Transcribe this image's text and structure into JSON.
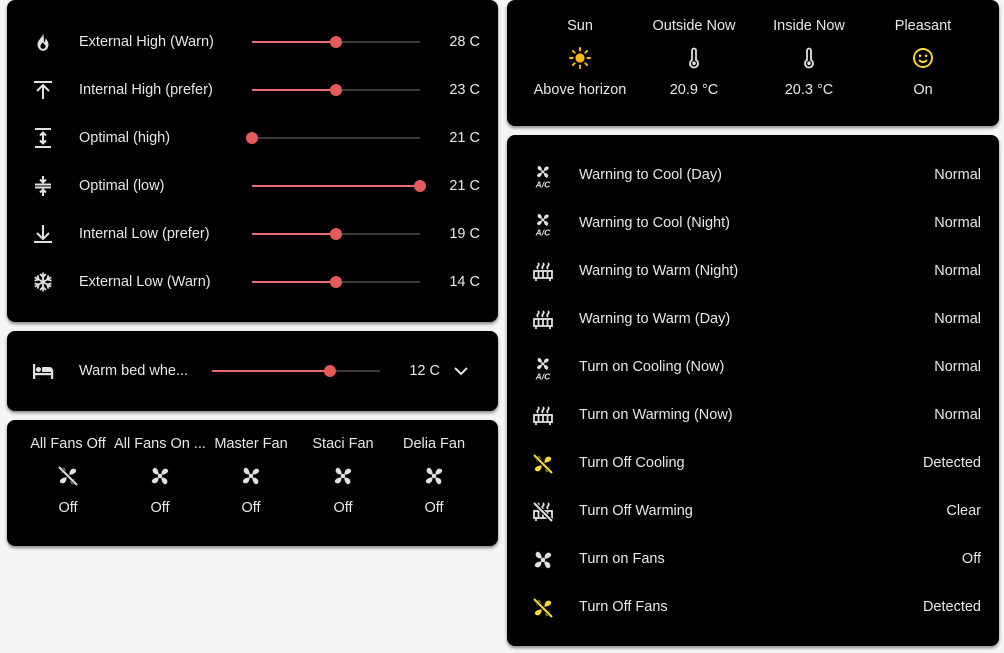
{
  "thresholds": [
    {
      "label": "External High (Warn)",
      "value": "28 C",
      "icon": "fire-icon",
      "fraction": 0.5
    },
    {
      "label": "Internal High (prefer)",
      "value": "23 C",
      "icon": "arrow-collapse-up-icon",
      "fraction": 0.5
    },
    {
      "label": "Optimal (high)",
      "value": "21 C",
      "icon": "arrow-expand-vertical-icon",
      "fraction": 0.0
    },
    {
      "label": "Optimal (low)",
      "value": "21 C",
      "icon": "arrow-collapse-vertical-icon",
      "fraction": 1.0
    },
    {
      "label": "Internal Low (prefer)",
      "value": "19 C",
      "icon": "arrow-collapse-down-icon",
      "fraction": 0.5
    },
    {
      "label": "External Low (Warn)",
      "value": "14 C",
      "icon": "snowflake-icon",
      "fraction": 0.5
    }
  ],
  "bed": {
    "label": "Warm bed whe...",
    "value": "12 C",
    "icon": "bed-icon",
    "fraction": 0.7
  },
  "fans": [
    {
      "name": "All Fans Off",
      "state": "Off",
      "icon": "fan-off-icon"
    },
    {
      "name": "All Fans On ...",
      "state": "Off",
      "icon": "fan-icon"
    },
    {
      "name": "Master Fan",
      "state": "Off",
      "icon": "fan-icon"
    },
    {
      "name": "Staci Fan",
      "state": "Off",
      "icon": "fan-icon"
    },
    {
      "name": "Delia Fan",
      "state": "Off",
      "icon": "fan-icon"
    }
  ],
  "weather": [
    {
      "name": "Sun",
      "state": "Above horizon",
      "icon": "sun-icon"
    },
    {
      "name": "Outside Now",
      "state": "20.9 °C",
      "icon": "thermometer-icon"
    },
    {
      "name": "Inside Now",
      "state": "20.3 °C",
      "icon": "thermometer-icon"
    },
    {
      "name": "Pleasant",
      "state": "On",
      "icon": "smiley-icon"
    }
  ],
  "status": [
    {
      "label": "Warning to Cool (Day)",
      "value": "Normal",
      "icon": "air-conditioner-icon",
      "active": false
    },
    {
      "label": "Warning to Cool (Night)",
      "value": "Normal",
      "icon": "air-conditioner-icon",
      "active": false
    },
    {
      "label": "Warning to Warm (Night)",
      "value": "Normal",
      "icon": "radiator-icon",
      "active": false
    },
    {
      "label": "Warning to Warm (Day)",
      "value": "Normal",
      "icon": "radiator-icon",
      "active": false
    },
    {
      "label": "Turn on Cooling (Now)",
      "value": "Normal",
      "icon": "air-conditioner-icon",
      "active": false
    },
    {
      "label": "Turn on Warming (Now)",
      "value": "Normal",
      "icon": "radiator-icon",
      "active": false
    },
    {
      "label": "Turn Off Cooling",
      "value": "Detected",
      "icon": "fan-off-icon",
      "active": true
    },
    {
      "label": "Turn Off Warming",
      "value": "Clear",
      "icon": "radiator-off-icon",
      "active": false
    },
    {
      "label": "Turn on Fans",
      "value": "Off",
      "icon": "fan-icon",
      "active": false
    },
    {
      "label": "Turn Off Fans",
      "value": "Detected",
      "icon": "fan-off-icon",
      "active": true
    }
  ],
  "colors": {
    "accent": "#e45a5a",
    "active_icon": "#fdd835",
    "icon": "#e1e1e1",
    "card": "#000000",
    "page": "#f5f5f5"
  }
}
